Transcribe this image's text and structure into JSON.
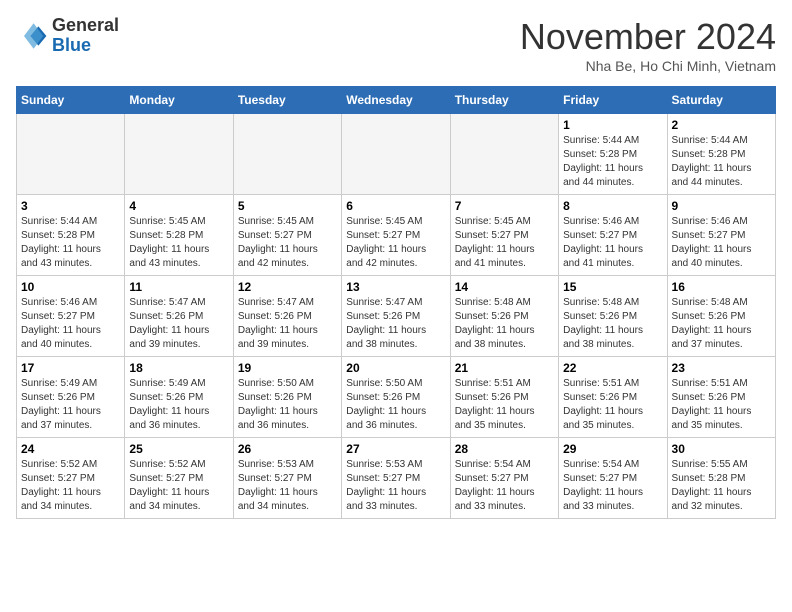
{
  "header": {
    "logo_general": "General",
    "logo_blue": "Blue",
    "month_title": "November 2024",
    "location": "Nha Be, Ho Chi Minh, Vietnam"
  },
  "weekdays": [
    "Sunday",
    "Monday",
    "Tuesday",
    "Wednesday",
    "Thursday",
    "Friday",
    "Saturday"
  ],
  "weeks": [
    [
      {
        "day": "",
        "info": ""
      },
      {
        "day": "",
        "info": ""
      },
      {
        "day": "",
        "info": ""
      },
      {
        "day": "",
        "info": ""
      },
      {
        "day": "",
        "info": ""
      },
      {
        "day": "1",
        "info": "Sunrise: 5:44 AM\nSunset: 5:28 PM\nDaylight: 11 hours\nand 44 minutes."
      },
      {
        "day": "2",
        "info": "Sunrise: 5:44 AM\nSunset: 5:28 PM\nDaylight: 11 hours\nand 44 minutes."
      }
    ],
    [
      {
        "day": "3",
        "info": "Sunrise: 5:44 AM\nSunset: 5:28 PM\nDaylight: 11 hours\nand 43 minutes."
      },
      {
        "day": "4",
        "info": "Sunrise: 5:45 AM\nSunset: 5:28 PM\nDaylight: 11 hours\nand 43 minutes."
      },
      {
        "day": "5",
        "info": "Sunrise: 5:45 AM\nSunset: 5:27 PM\nDaylight: 11 hours\nand 42 minutes."
      },
      {
        "day": "6",
        "info": "Sunrise: 5:45 AM\nSunset: 5:27 PM\nDaylight: 11 hours\nand 42 minutes."
      },
      {
        "day": "7",
        "info": "Sunrise: 5:45 AM\nSunset: 5:27 PM\nDaylight: 11 hours\nand 41 minutes."
      },
      {
        "day": "8",
        "info": "Sunrise: 5:46 AM\nSunset: 5:27 PM\nDaylight: 11 hours\nand 41 minutes."
      },
      {
        "day": "9",
        "info": "Sunrise: 5:46 AM\nSunset: 5:27 PM\nDaylight: 11 hours\nand 40 minutes."
      }
    ],
    [
      {
        "day": "10",
        "info": "Sunrise: 5:46 AM\nSunset: 5:27 PM\nDaylight: 11 hours\nand 40 minutes."
      },
      {
        "day": "11",
        "info": "Sunrise: 5:47 AM\nSunset: 5:26 PM\nDaylight: 11 hours\nand 39 minutes."
      },
      {
        "day": "12",
        "info": "Sunrise: 5:47 AM\nSunset: 5:26 PM\nDaylight: 11 hours\nand 39 minutes."
      },
      {
        "day": "13",
        "info": "Sunrise: 5:47 AM\nSunset: 5:26 PM\nDaylight: 11 hours\nand 38 minutes."
      },
      {
        "day": "14",
        "info": "Sunrise: 5:48 AM\nSunset: 5:26 PM\nDaylight: 11 hours\nand 38 minutes."
      },
      {
        "day": "15",
        "info": "Sunrise: 5:48 AM\nSunset: 5:26 PM\nDaylight: 11 hours\nand 38 minutes."
      },
      {
        "day": "16",
        "info": "Sunrise: 5:48 AM\nSunset: 5:26 PM\nDaylight: 11 hours\nand 37 minutes."
      }
    ],
    [
      {
        "day": "17",
        "info": "Sunrise: 5:49 AM\nSunset: 5:26 PM\nDaylight: 11 hours\nand 37 minutes."
      },
      {
        "day": "18",
        "info": "Sunrise: 5:49 AM\nSunset: 5:26 PM\nDaylight: 11 hours\nand 36 minutes."
      },
      {
        "day": "19",
        "info": "Sunrise: 5:50 AM\nSunset: 5:26 PM\nDaylight: 11 hours\nand 36 minutes."
      },
      {
        "day": "20",
        "info": "Sunrise: 5:50 AM\nSunset: 5:26 PM\nDaylight: 11 hours\nand 36 minutes."
      },
      {
        "day": "21",
        "info": "Sunrise: 5:51 AM\nSunset: 5:26 PM\nDaylight: 11 hours\nand 35 minutes."
      },
      {
        "day": "22",
        "info": "Sunrise: 5:51 AM\nSunset: 5:26 PM\nDaylight: 11 hours\nand 35 minutes."
      },
      {
        "day": "23",
        "info": "Sunrise: 5:51 AM\nSunset: 5:26 PM\nDaylight: 11 hours\nand 35 minutes."
      }
    ],
    [
      {
        "day": "24",
        "info": "Sunrise: 5:52 AM\nSunset: 5:27 PM\nDaylight: 11 hours\nand 34 minutes."
      },
      {
        "day": "25",
        "info": "Sunrise: 5:52 AM\nSunset: 5:27 PM\nDaylight: 11 hours\nand 34 minutes."
      },
      {
        "day": "26",
        "info": "Sunrise: 5:53 AM\nSunset: 5:27 PM\nDaylight: 11 hours\nand 34 minutes."
      },
      {
        "day": "27",
        "info": "Sunrise: 5:53 AM\nSunset: 5:27 PM\nDaylight: 11 hours\nand 33 minutes."
      },
      {
        "day": "28",
        "info": "Sunrise: 5:54 AM\nSunset: 5:27 PM\nDaylight: 11 hours\nand 33 minutes."
      },
      {
        "day": "29",
        "info": "Sunrise: 5:54 AM\nSunset: 5:27 PM\nDaylight: 11 hours\nand 33 minutes."
      },
      {
        "day": "30",
        "info": "Sunrise: 5:55 AM\nSunset: 5:28 PM\nDaylight: 11 hours\nand 32 minutes."
      }
    ]
  ]
}
